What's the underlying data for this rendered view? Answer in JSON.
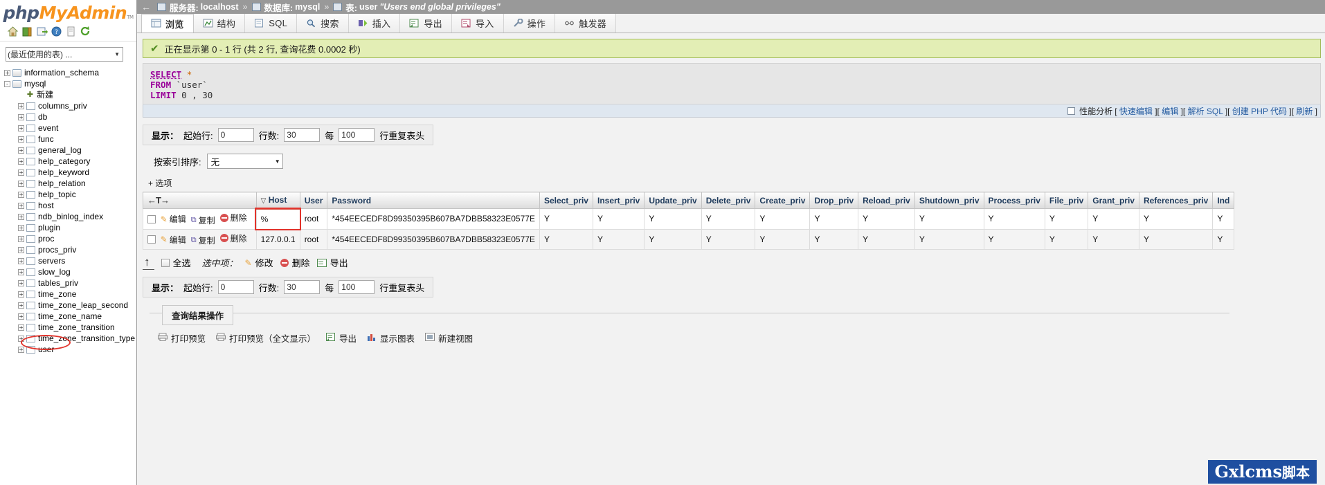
{
  "sidebar": {
    "logo": {
      "php": "php",
      "my": "My",
      "admin": "Admin",
      "tm": "TM"
    },
    "icons": [
      {
        "name": "home-icon",
        "title": "主页"
      },
      {
        "name": "logout-icon",
        "title": "退出"
      },
      {
        "name": "sql-icon",
        "title": "SQL"
      },
      {
        "name": "help-icon",
        "title": "帮助"
      },
      {
        "name": "docs-icon",
        "title": "文档"
      },
      {
        "name": "reload-icon",
        "title": "重新加载"
      }
    ],
    "recent_select": {
      "value": "(最近使用的表) ...",
      "caret": "▼"
    },
    "tree": [
      {
        "label": "information_schema",
        "type": "db",
        "indent": 0,
        "expander": "+"
      },
      {
        "label": "mysql",
        "type": "db",
        "indent": 0,
        "expander": "-"
      },
      {
        "label": "新建",
        "type": "new",
        "indent": 1,
        "expander": ""
      },
      {
        "label": "columns_priv",
        "type": "table",
        "indent": 1,
        "expander": "+"
      },
      {
        "label": "db",
        "type": "table",
        "indent": 1,
        "expander": "+"
      },
      {
        "label": "event",
        "type": "table",
        "indent": 1,
        "expander": "+"
      },
      {
        "label": "func",
        "type": "table",
        "indent": 1,
        "expander": "+"
      },
      {
        "label": "general_log",
        "type": "table",
        "indent": 1,
        "expander": "+"
      },
      {
        "label": "help_category",
        "type": "table",
        "indent": 1,
        "expander": "+"
      },
      {
        "label": "help_keyword",
        "type": "table",
        "indent": 1,
        "expander": "+"
      },
      {
        "label": "help_relation",
        "type": "table",
        "indent": 1,
        "expander": "+"
      },
      {
        "label": "help_topic",
        "type": "table",
        "indent": 1,
        "expander": "+"
      },
      {
        "label": "host",
        "type": "table",
        "indent": 1,
        "expander": "+"
      },
      {
        "label": "ndb_binlog_index",
        "type": "table",
        "indent": 1,
        "expander": "+"
      },
      {
        "label": "plugin",
        "type": "table",
        "indent": 1,
        "expander": "+"
      },
      {
        "label": "proc",
        "type": "table",
        "indent": 1,
        "expander": "+"
      },
      {
        "label": "procs_priv",
        "type": "table",
        "indent": 1,
        "expander": "+"
      },
      {
        "label": "servers",
        "type": "table",
        "indent": 1,
        "expander": "+"
      },
      {
        "label": "slow_log",
        "type": "table",
        "indent": 1,
        "expander": "+"
      },
      {
        "label": "tables_priv",
        "type": "table",
        "indent": 1,
        "expander": "+"
      },
      {
        "label": "time_zone",
        "type": "table",
        "indent": 1,
        "expander": "+"
      },
      {
        "label": "time_zone_leap_second",
        "type": "table",
        "indent": 1,
        "expander": "+"
      },
      {
        "label": "time_zone_name",
        "type": "table",
        "indent": 1,
        "expander": "+"
      },
      {
        "label": "time_zone_transition",
        "type": "table",
        "indent": 1,
        "expander": "+"
      },
      {
        "label": "time_zone_transition_type",
        "type": "table",
        "indent": 1,
        "expander": "+"
      },
      {
        "label": "user",
        "type": "table",
        "indent": 1,
        "expander": "+",
        "highlighted": true
      }
    ]
  },
  "breadcrumb": {
    "back": "←",
    "server_label": "服务器:",
    "server_value": "localhost",
    "db_label": "数据库:",
    "db_value": "mysql",
    "table_label": "表:",
    "table_value": "user",
    "table_comment": "\"Users end global privileges\"",
    "sep": "»"
  },
  "tabs": [
    {
      "label": "浏览",
      "icon": "browse-icon",
      "active": true
    },
    {
      "label": "结构",
      "icon": "structure-icon",
      "active": false
    },
    {
      "label": "SQL",
      "icon": "sql-icon",
      "active": false
    },
    {
      "label": "搜索",
      "icon": "search-icon",
      "active": false
    },
    {
      "label": "插入",
      "icon": "insert-icon",
      "active": false
    },
    {
      "label": "导出",
      "icon": "export-icon",
      "active": false
    },
    {
      "label": "导入",
      "icon": "import-icon",
      "active": false
    },
    {
      "label": "操作",
      "icon": "operations-icon",
      "active": false
    },
    {
      "label": "触发器",
      "icon": "triggers-icon",
      "active": false
    }
  ],
  "notice": {
    "check": "✔",
    "text": "正在显示第 0 - 1 行 (共 2 行, 查询花费 0.0002 秒)"
  },
  "sql": {
    "line1_kw": "SELECT",
    "line1_star": "*",
    "line2_kw": "FROM",
    "line2_obj": "`user`",
    "line3_kw": "LIMIT",
    "line3_val": "0 , 30"
  },
  "sql_actions": {
    "profiling": "性能分析",
    "links": [
      "快速编辑",
      "编辑",
      "解析 SQL",
      "创建 PHP 代码",
      "刷新"
    ],
    "open_bracket": "[",
    "close_bracket": "]"
  },
  "display_top": {
    "show_label": "显示：",
    "start_label": "起始行:",
    "start_value": "0",
    "rows_label": "行数:",
    "rows_value": "30",
    "every_label": "每",
    "every_value": "100",
    "repeat_label": "行重复表头"
  },
  "display_bottom": {
    "show_label": "显示：",
    "start_label": "起始行:",
    "start_value": "0",
    "rows_label": "行数:",
    "rows_value": "30",
    "every_label": "每",
    "every_value": "100",
    "repeat_label": "行重复表头"
  },
  "sort": {
    "label": "按索引排序:",
    "value": "无",
    "caret": "▼"
  },
  "options_toggle": "+ 选项",
  "table": {
    "nav_arrows": "←T→",
    "sort_caret": "▽",
    "columns": [
      "Host",
      "User",
      "Password",
      "Select_priv",
      "Insert_priv",
      "Update_priv",
      "Delete_priv",
      "Create_priv",
      "Drop_priv",
      "Reload_priv",
      "Shutdown_priv",
      "Process_priv",
      "File_priv",
      "Grant_priv",
      "References_priv",
      "Ind"
    ],
    "sorted_column": "Host",
    "row_actions": {
      "edit": "编辑",
      "copy": "复制",
      "delete": "删除"
    },
    "rows": [
      {
        "highlight_host": true,
        "cells": [
          "%",
          "root",
          "*454EECEDF8D99350395B607BA7DBB58323E0577E",
          "Y",
          "Y",
          "Y",
          "Y",
          "Y",
          "Y",
          "Y",
          "Y",
          "Y",
          "Y",
          "Y",
          "Y",
          "Y"
        ]
      },
      {
        "highlight_host": false,
        "cells": [
          "127.0.0.1",
          "root",
          "*454EECEDF8D99350395B607BA7DBB58323E0577E",
          "Y",
          "Y",
          "Y",
          "Y",
          "Y",
          "Y",
          "Y",
          "Y",
          "Y",
          "Y",
          "Y",
          "Y",
          "Y"
        ]
      }
    ]
  },
  "selection_bar": {
    "up_arrow": "↑",
    "select_all": "全选",
    "with_selected": "选中项：",
    "edit": "修改",
    "delete": "删除",
    "export": "导出"
  },
  "query_results_ops": {
    "legend": "查询结果操作",
    "links": [
      {
        "label": "打印预览",
        "icon": "print-icon"
      },
      {
        "label": "打印预览（全文显示）",
        "icon": "print-icon"
      },
      {
        "label": "导出",
        "icon": "export-icon"
      },
      {
        "label": "显示图表",
        "icon": "chart-icon"
      },
      {
        "label": "新建视图",
        "icon": "view-icon"
      }
    ]
  },
  "watermark": {
    "en": "Gxlcms",
    "cn": "脚本"
  },
  "colors": {
    "accent": "#1f4fa0",
    "notice_bg": "#e3eeb5",
    "notice_border": "#a2bc5a",
    "breadcrumb_bg": "#999999",
    "highlight_red": "#e2332b",
    "link_blue": "#235a9f",
    "header_text": "#1f3b5c"
  }
}
